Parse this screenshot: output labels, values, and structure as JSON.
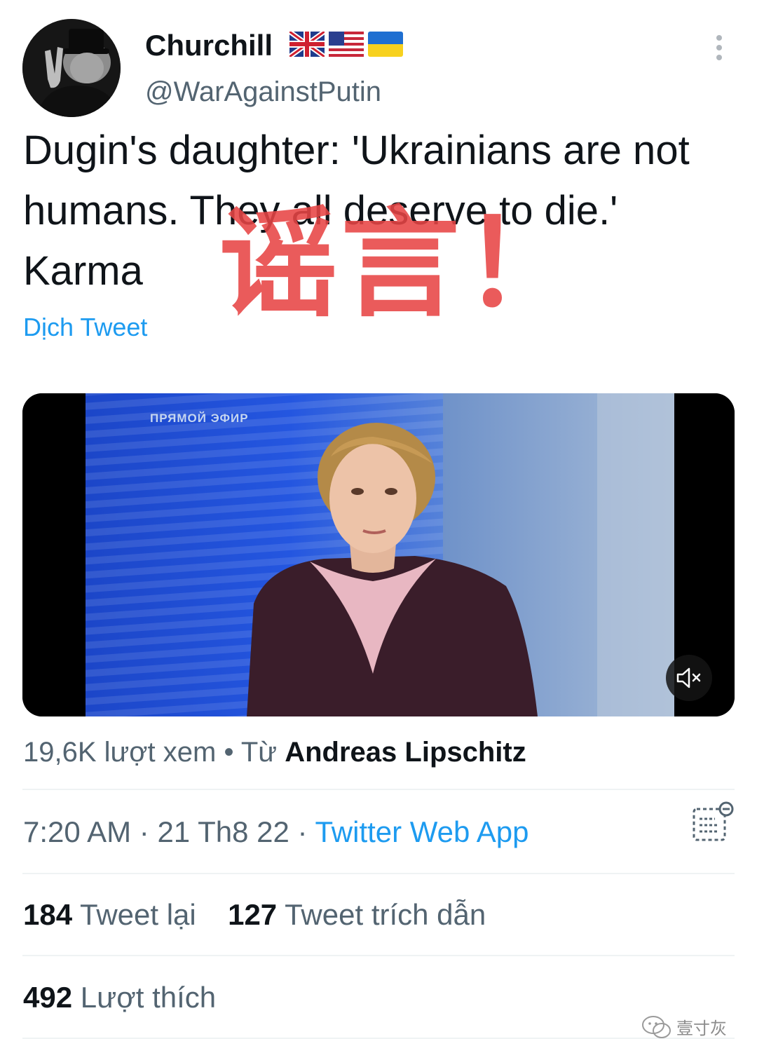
{
  "tweet": {
    "author": {
      "display_name": "Churchill",
      "handle": "@WarAgainstPutin",
      "flags": [
        "uk-flag-icon",
        "us-flag-icon",
        "ukraine-flag-icon"
      ]
    },
    "text": "Dugin's daughter: 'Ukrainians are not humans. They all deserve to die.' Karma",
    "translate_label": "Dịch Tweet",
    "overlay_stamp": "谣言！",
    "video": {
      "caption": "ПРЯМОЙ ЭФИР",
      "mute_icon": "muted-speaker-icon"
    },
    "views": {
      "count_text": "19,6K lượt xem",
      "separator": "•",
      "from_label": "Từ",
      "from_author": "Andreas Lipschitz"
    },
    "timestamp": {
      "time": "7:20 AM",
      "sep1": "·",
      "date": "21 Th8 22",
      "sep2": "·",
      "source": "Twitter Web App"
    },
    "stats": {
      "retweets_count": "184",
      "retweets_label": "Tweet lại",
      "quotes_count": "127",
      "quotes_label": "Tweet trích dẫn",
      "likes_count": "492",
      "likes_label": "Lượt thích"
    }
  },
  "watermark": {
    "text": "壹寸灰"
  },
  "colors": {
    "link": "#1d9bf0",
    "secondary_text": "#536471",
    "primary_text": "#0f1419",
    "stamp": "#e74444"
  }
}
